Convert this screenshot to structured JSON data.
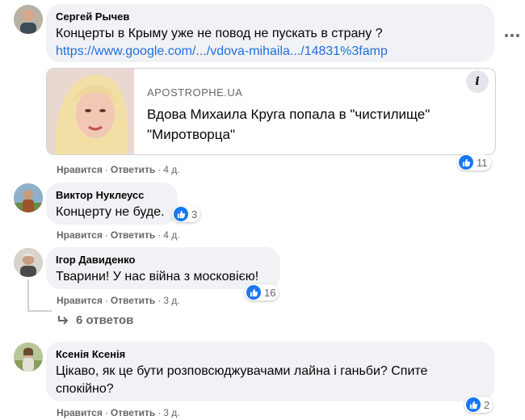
{
  "colors": {
    "link": "#216fdb",
    "like": "#1877f2",
    "bubble": "#f0f2f5",
    "meta": "#65676b"
  },
  "comments": [
    {
      "author": "Сергей Рычев",
      "text": "Концерты в Крыму уже не повод не пускать в страну ?",
      "link": "https://www.google.com/.../vdova-mihaila.../14831%3famp",
      "preview": {
        "domain": "APOSTROPHE.UA",
        "title": "Вдова Михаила Круга попала в \"чистилище\" \"Миротворца\"",
        "info_icon": "i"
      },
      "reactions": "11",
      "like": "Нравится",
      "reply": "Ответить",
      "time": "4 д."
    },
    {
      "author": "Виктор Нуклеусс",
      "text": "Концерту не буде.",
      "reactions": "3",
      "like": "Нравится",
      "reply": "Ответить",
      "time": "4 д."
    },
    {
      "author": "Ігор Давиденко",
      "text": "Тварини! У нас війна з московією!",
      "reactions": "16",
      "like": "Нравится",
      "reply": "Ответить",
      "time": "3 д.",
      "replies": "6 ответов"
    },
    {
      "author": "Ксенія Ксенія",
      "text_line1": "Цікаво, як це бути розповсюджувачами лайна і ганьби? Спите",
      "text_line2": "спокійно?",
      "reactions": "2",
      "like": "Нравится",
      "reply": "Ответить",
      "time": "3 д."
    }
  ],
  "separator": "·"
}
